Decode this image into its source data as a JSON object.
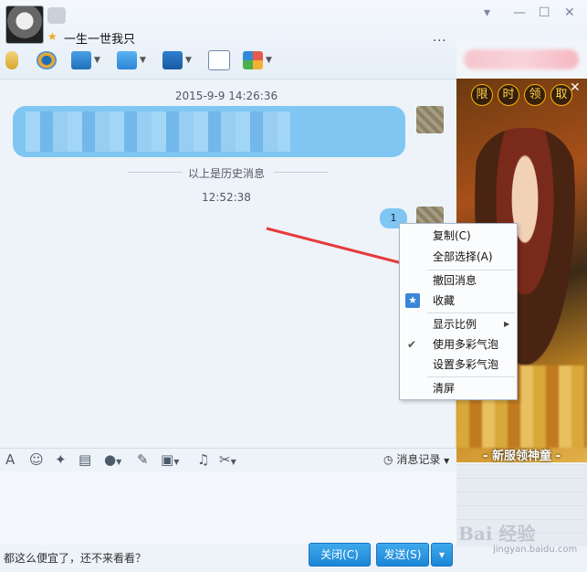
{
  "header": {
    "contact_name": "一生一世我只",
    "more": "..."
  },
  "chat": {
    "timestamp1": "2015-9-9 14:26:36",
    "history_divider": "以上是历史消息",
    "timestamp2": "12:52:38",
    "my_message": "1"
  },
  "context_menu": {
    "items": [
      {
        "label": "复制(C)"
      },
      {
        "label": "全部选择(A)"
      },
      {
        "label": "撤回消息"
      },
      {
        "label": "收藏"
      },
      {
        "label": "显示比例"
      },
      {
        "label": "使用多彩气泡"
      },
      {
        "label": "设置多彩气泡"
      },
      {
        "label": "清屏"
      }
    ]
  },
  "ad": {
    "chips": [
      "限",
      "时",
      "领",
      "取"
    ],
    "caption": "- 新服领神童 -"
  },
  "input_toolbar": {
    "history_label": "消息记录"
  },
  "input": {
    "draft": "都这么便宜了，还不来看看？"
  },
  "buttons": {
    "close": "关闭(C)",
    "send": "发送(S)"
  },
  "watermark": {
    "brand": "Bai 经验",
    "url": "jingyan.baidu.com"
  },
  "colors": {
    "bubble": "#7fc6f3",
    "button": "#1c86d8",
    "arrow": "#e53b3b"
  }
}
